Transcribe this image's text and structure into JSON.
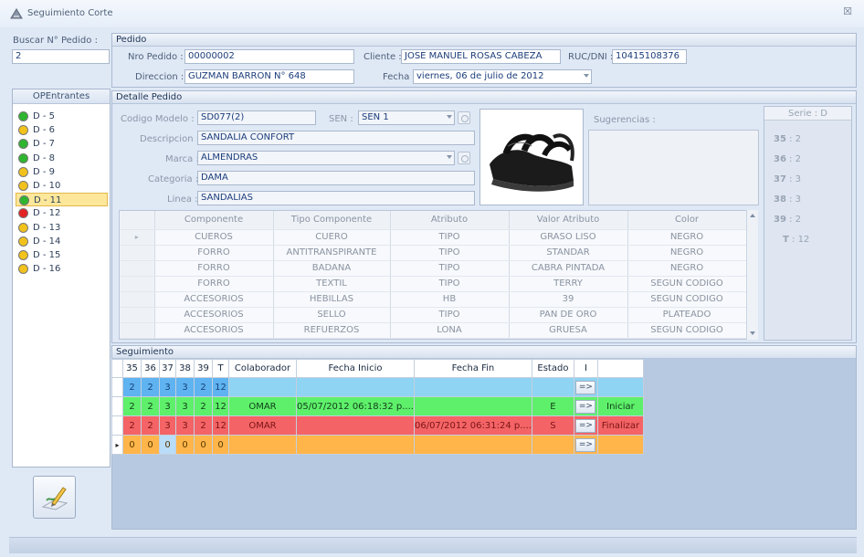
{
  "window": {
    "title": "Seguimiento Corte",
    "close_glyph": "☒"
  },
  "search": {
    "label": "Buscar N° Pedido :",
    "value": "2"
  },
  "op_list": {
    "header": "OPEntrantes",
    "items": [
      {
        "label": "D - 5",
        "status": "green"
      },
      {
        "label": "D - 6",
        "status": "yellow"
      },
      {
        "label": "D - 7",
        "status": "green"
      },
      {
        "label": "D - 8",
        "status": "green"
      },
      {
        "label": "D - 9",
        "status": "yellow"
      },
      {
        "label": "D - 10",
        "status": "yellow"
      },
      {
        "label": "D - 11",
        "status": "green",
        "selected": true
      },
      {
        "label": "D - 12",
        "status": "red"
      },
      {
        "label": "D - 13",
        "status": "yellow"
      },
      {
        "label": "D - 14",
        "status": "yellow"
      },
      {
        "label": "D - 15",
        "status": "yellow"
      },
      {
        "label": "D - 16",
        "status": "yellow"
      }
    ]
  },
  "pedido": {
    "title": "Pedido",
    "nro_label": "Nro Pedido :",
    "nro_value": "00000002",
    "cliente_label": "Cliente :",
    "cliente_value": "JOSE MANUEL ROSAS CABEZA",
    "ruc_label": "RUC/DNI :",
    "ruc_value": "10415108376",
    "direccion_label": "Direccion :",
    "direccion_value": "GUZMAN BARRON N° 648",
    "fecha_label": "Fecha :",
    "fecha_value": "viernes, 06 de julio de 2012"
  },
  "detalle": {
    "title": "Detalle Pedido",
    "codigo_label": "Codigo Modelo :",
    "codigo_value": "SD077(2)",
    "sen_label": "SEN :",
    "sen_value": "SEN 1",
    "descripcion_label": "Descripcion :",
    "descripcion_value": "SANDALIA CONFORT",
    "marca_label": "Marca :",
    "marca_value": "ALMENDRAS",
    "categoria_label": "Categoria :",
    "categoria_value": "DAMA",
    "linea_label": "Linea :",
    "linea_value": "SANDALIAS",
    "sugerencias_label": "Sugerencias :",
    "serie": {
      "title": "Serie : D",
      "sizes": [
        {
          "size": "35",
          "qty": "2"
        },
        {
          "size": "36",
          "qty": "2"
        },
        {
          "size": "37",
          "qty": "3"
        },
        {
          "size": "38",
          "qty": "3"
        },
        {
          "size": "39",
          "qty": "2"
        },
        {
          "size": "T",
          "qty": "12"
        }
      ]
    },
    "components": {
      "columns": [
        "Componente",
        "Tipo Componente",
        "Atributo",
        "Valor Atributo",
        "Color"
      ],
      "rows": [
        [
          "CUEROS",
          "CUERO",
          "TIPO",
          "GRASO LISO",
          "NEGRO"
        ],
        [
          "FORRO",
          "ANTITRANSPIRANTE",
          "TIPO",
          "STANDAR",
          "NEGRO"
        ],
        [
          "FORRO",
          "BADANA",
          "TIPO",
          "CABRA PINTADA",
          "NEGRO"
        ],
        [
          "FORRO",
          "TEXTIL",
          "TIPO",
          "TERRY",
          "SEGUN CODIGO"
        ],
        [
          "ACCESORIOS",
          "HEBILLAS",
          "HB",
          "39",
          "SEGUN CODIGO"
        ],
        [
          "ACCESORIOS",
          "SELLO",
          "TIPO",
          "PAN DE ORO",
          "PLATEADO"
        ],
        [
          "ACCESORIOS",
          "REFUERZOS",
          "LONA",
          "GRUESA",
          "SEGUN CODIGO"
        ]
      ]
    }
  },
  "seguimiento": {
    "title": "Seguimiento",
    "columns": [
      "35",
      "36",
      "37",
      "38",
      "39",
      "T",
      "Colaborador",
      "Fecha Inicio",
      "Fecha Fin",
      "Estado",
      "I",
      ""
    ],
    "rows": [
      {
        "color": "blue",
        "values": [
          "2",
          "2",
          "3",
          "3",
          "2",
          "12",
          "",
          "",
          "",
          "",
          "=>",
          ""
        ]
      },
      {
        "color": "green",
        "values": [
          "2",
          "2",
          "3",
          "3",
          "2",
          "12",
          "OMAR",
          "05/07/2012 06:18:32 p....",
          "",
          "E",
          "=>",
          "Iniciar"
        ]
      },
      {
        "color": "red",
        "values": [
          "2",
          "2",
          "3",
          "3",
          "2",
          "12",
          "OMAR",
          "",
          "06/07/2012 06:31:24 p....",
          "S",
          "=>",
          "Finalizar"
        ]
      },
      {
        "color": "orange",
        "values": [
          "0",
          "0",
          "0",
          "0",
          "0",
          "0",
          "",
          "",
          "",
          "",
          "=>",
          ""
        ]
      }
    ]
  }
}
